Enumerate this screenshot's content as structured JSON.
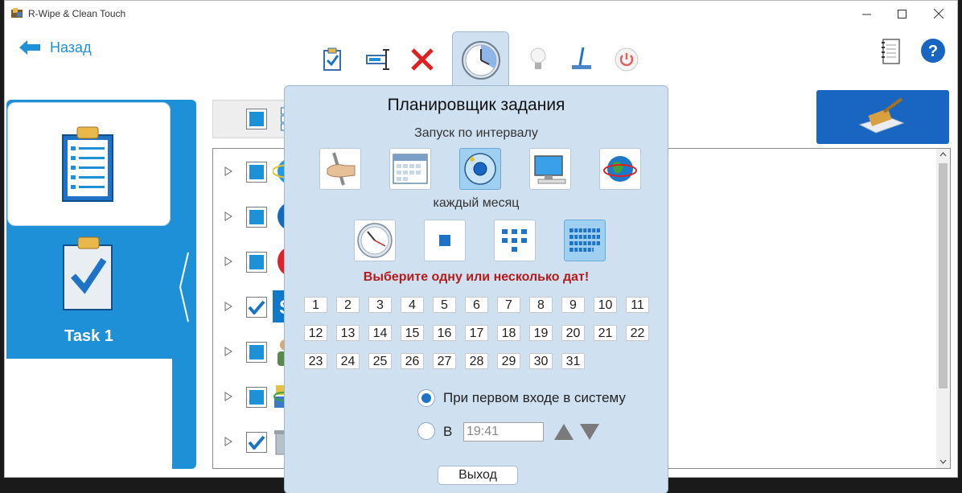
{
  "window": {
    "title": "R-Wipe & Clean Touch"
  },
  "nav": {
    "back_label": "Назад"
  },
  "tasks": [
    {
      "label": ""
    },
    {
      "label": "Task 1"
    }
  ],
  "scheduler": {
    "title": "Планировщик задания",
    "trigger_label": "Запуск по интервалу",
    "interval_label": "каждый месяц",
    "warning": "Выберите одну или несколько дат!",
    "days": [
      "1",
      "2",
      "3",
      "4",
      "5",
      "6",
      "7",
      "8",
      "9",
      "10",
      "11",
      "12",
      "13",
      "14",
      "15",
      "16",
      "17",
      "18",
      "19",
      "20",
      "21",
      "22",
      "23",
      "24",
      "25",
      "26",
      "27",
      "28",
      "29",
      "30",
      "31"
    ],
    "option_first_login": "При первом входе в систему",
    "option_at": "В",
    "time_value": "19:41",
    "exit_label": "Выход"
  },
  "colors": {
    "accent": "#1e90d8",
    "warning": "#b31b1b",
    "popup_bg": "#cfe0f1",
    "clean_button": "#1866c2"
  }
}
